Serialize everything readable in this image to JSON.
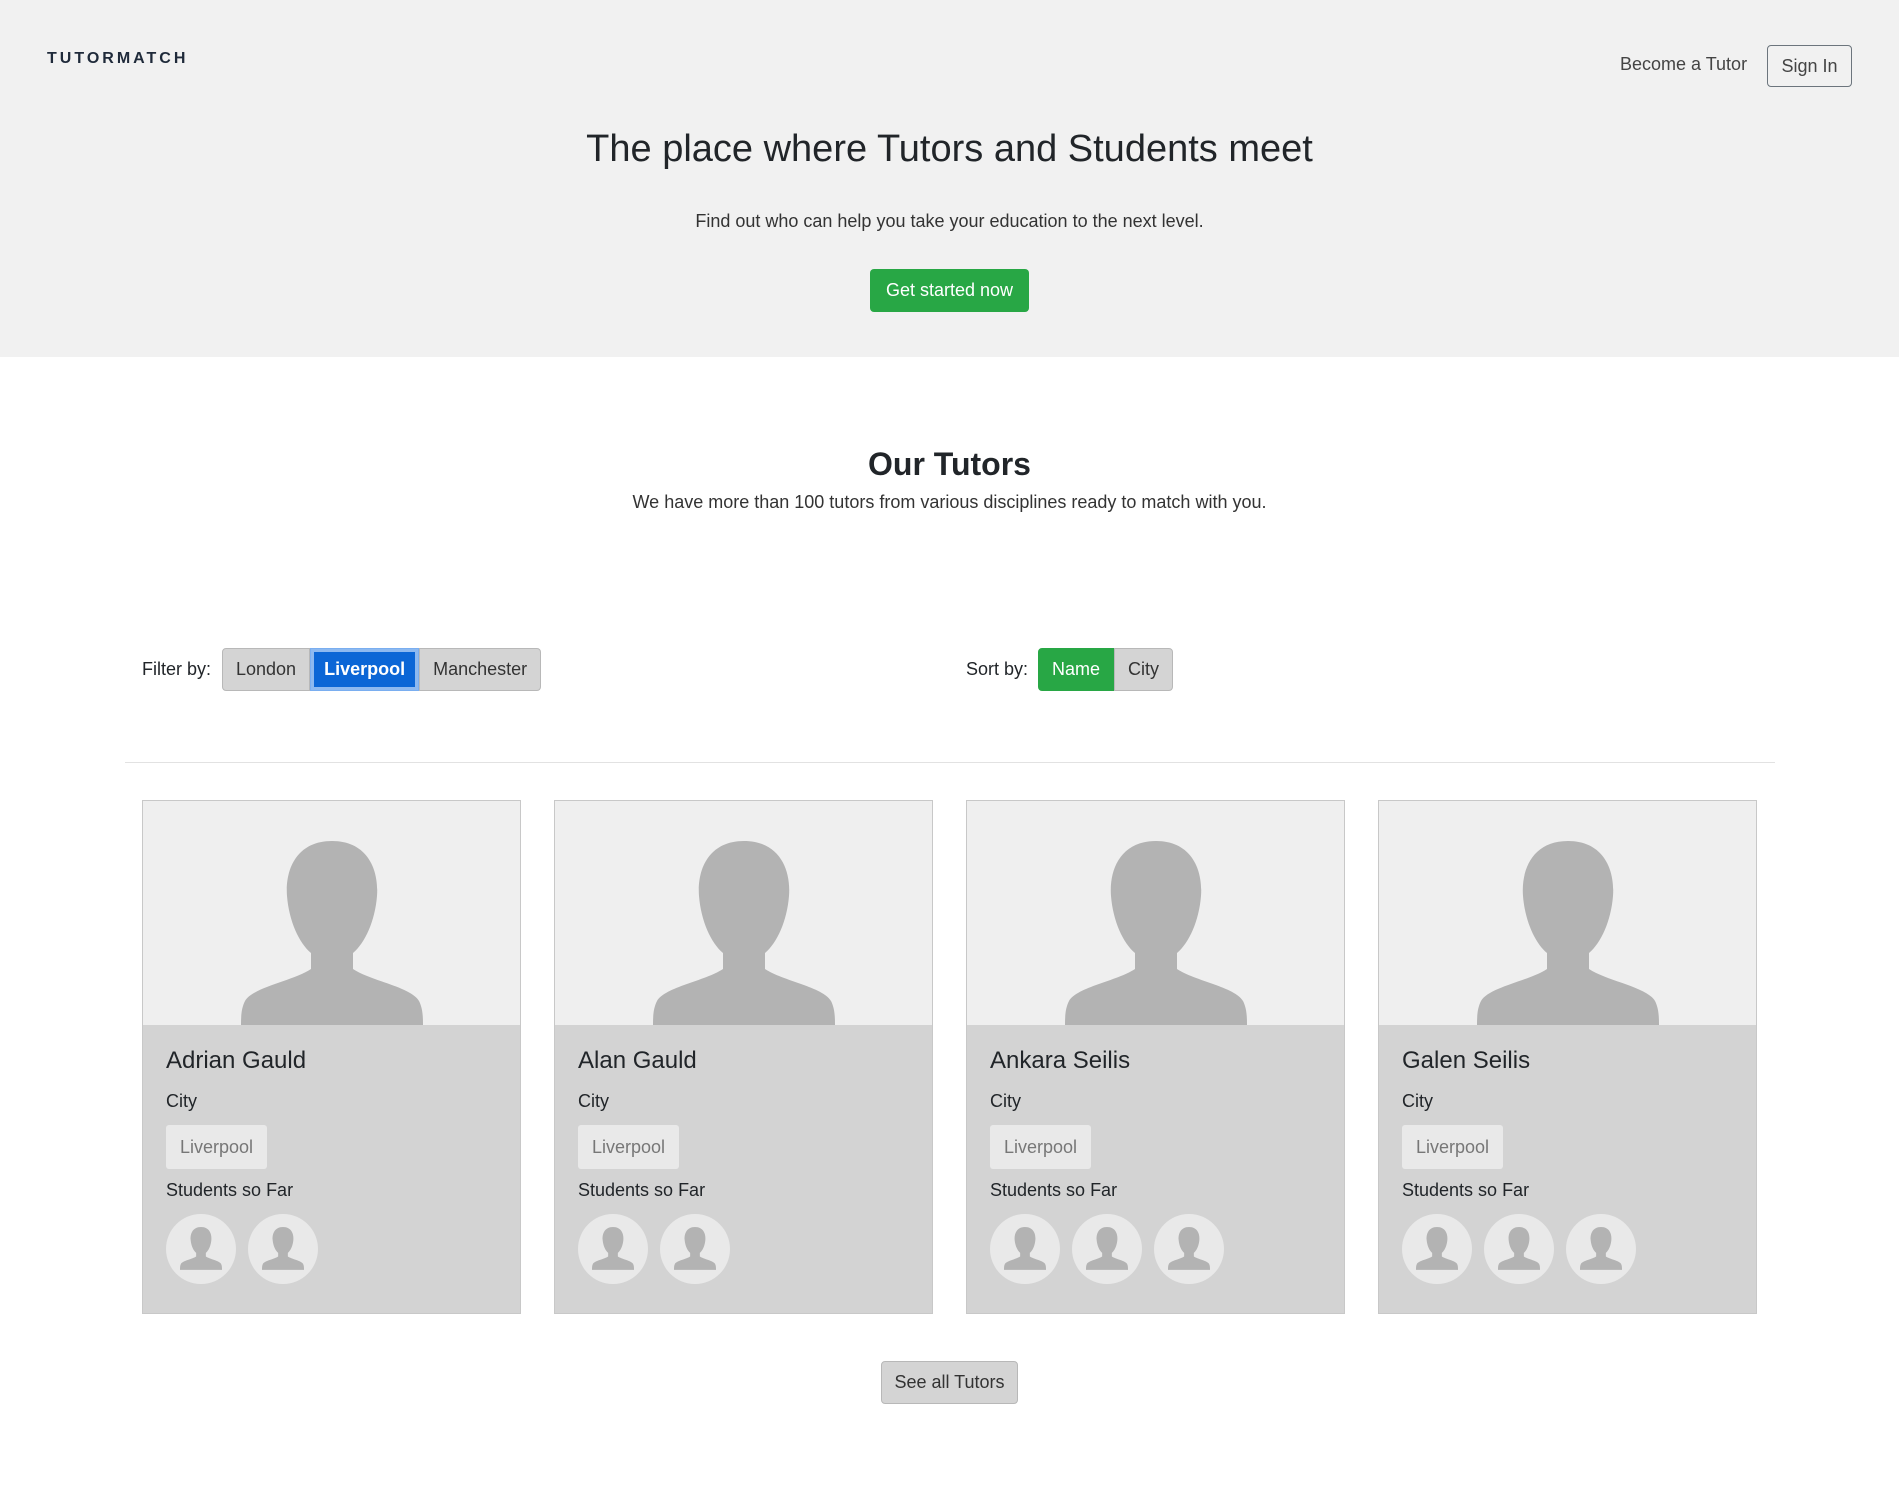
{
  "header": {
    "brand": "TUTORMATCH",
    "become_tutor": "Become a Tutor",
    "sign_in": "Sign In"
  },
  "hero": {
    "title": "The place where Tutors and Students meet",
    "subtitle": "Find out who can help you take your education to the next level.",
    "cta": "Get started now"
  },
  "tutors_section": {
    "title": "Our Tutors",
    "subtitle": "We have more than 100 tutors from various disciplines ready to match with you.",
    "filter_label": "Filter by:",
    "filters": [
      "London",
      "Liverpool",
      "Manchester"
    ],
    "active_filter": "Liverpool",
    "sort_label": "Sort by:",
    "sorts": [
      "Name",
      "City"
    ],
    "active_sort": "Name",
    "see_all": "See all Tutors"
  },
  "tutors": [
    {
      "name": "Adrian Gauld",
      "city_label": "City",
      "city": "Liverpool",
      "students_label": "Students so Far",
      "student_count": 2
    },
    {
      "name": "Alan Gauld",
      "city_label": "City",
      "city": "Liverpool",
      "students_label": "Students so Far",
      "student_count": 2
    },
    {
      "name": "Ankara Seilis",
      "city_label": "City",
      "city": "Liverpool",
      "students_label": "Students so Far",
      "student_count": 3
    },
    {
      "name": "Galen Seilis",
      "city_label": "City",
      "city": "Liverpool",
      "students_label": "Students so Far",
      "student_count": 3
    }
  ],
  "colors": {
    "accent_green": "#28a745",
    "active_blue": "#0b66d6",
    "hero_bg": "#f1f1f1",
    "card_bg": "#d3d3d3",
    "silhouette": "#b3b3b3"
  },
  "icons": {
    "profile_placeholder": "person-silhouette-icon",
    "student_avatar": "person-silhouette-icon"
  }
}
